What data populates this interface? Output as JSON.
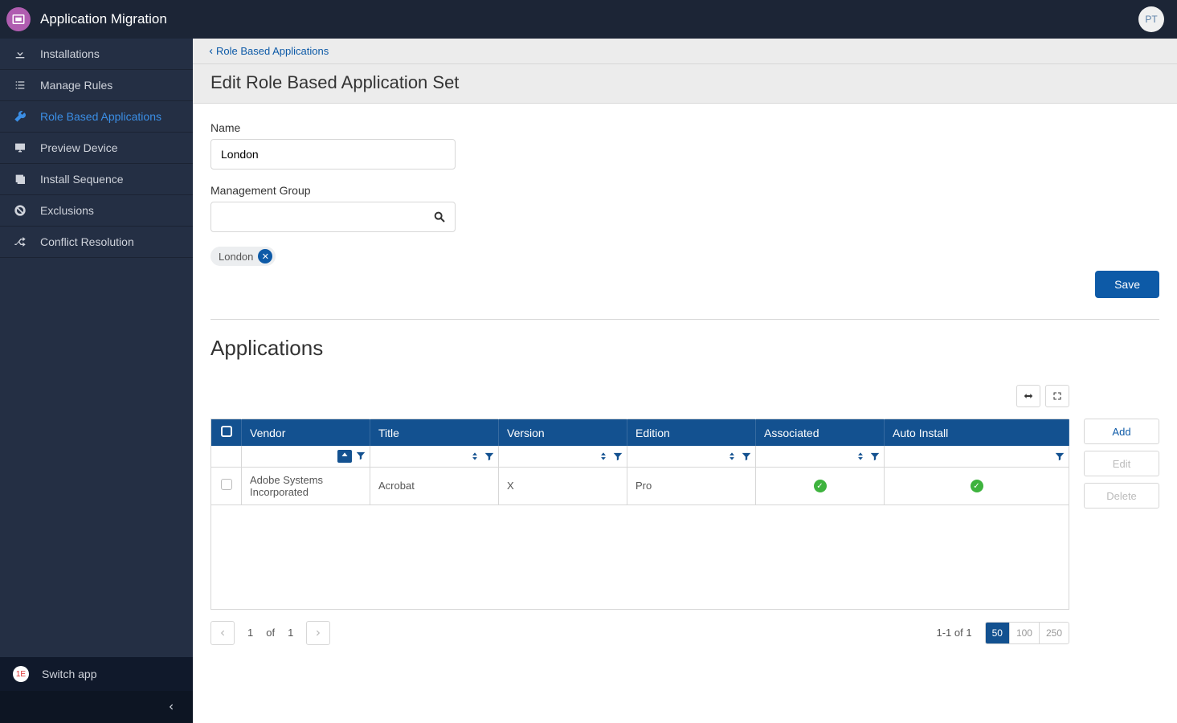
{
  "header": {
    "title": "Application Migration",
    "user_initials": "PT"
  },
  "sidebar": {
    "items": [
      {
        "label": "Installations",
        "icon": "download-icon"
      },
      {
        "label": "Manage Rules",
        "icon": "list-icon"
      },
      {
        "label": "Role Based Applications",
        "icon": "wrench-icon",
        "active": true
      },
      {
        "label": "Preview Device",
        "icon": "monitor-icon"
      },
      {
        "label": "Install Sequence",
        "icon": "stack-icon"
      },
      {
        "label": "Exclusions",
        "icon": "ban-icon"
      },
      {
        "label": "Conflict Resolution",
        "icon": "shuffle-icon"
      }
    ],
    "switch_app": "Switch app"
  },
  "breadcrumb": {
    "parent": "Role Based Applications"
  },
  "page": {
    "title": "Edit Role Based Application Set",
    "name_label": "Name",
    "name_value": "London",
    "mg_label": "Management Group",
    "mg_value": "",
    "chip": "London",
    "save": "Save",
    "section": "Applications"
  },
  "table": {
    "columns": [
      "Vendor",
      "Title",
      "Version",
      "Edition",
      "Associated",
      "Auto Install"
    ],
    "rows": [
      {
        "vendor": "Adobe Systems Incorporated",
        "title": "Acrobat",
        "version": "X",
        "edition": "Pro",
        "associated": true,
        "auto_install": true
      }
    ]
  },
  "pager": {
    "current": "1",
    "of": "of",
    "total": "1",
    "summary": "1-1 of 1",
    "sizes": [
      "50",
      "100",
      "250"
    ],
    "size_selected": "50"
  },
  "actions": {
    "add": "Add",
    "edit": "Edit",
    "del": "Delete"
  }
}
